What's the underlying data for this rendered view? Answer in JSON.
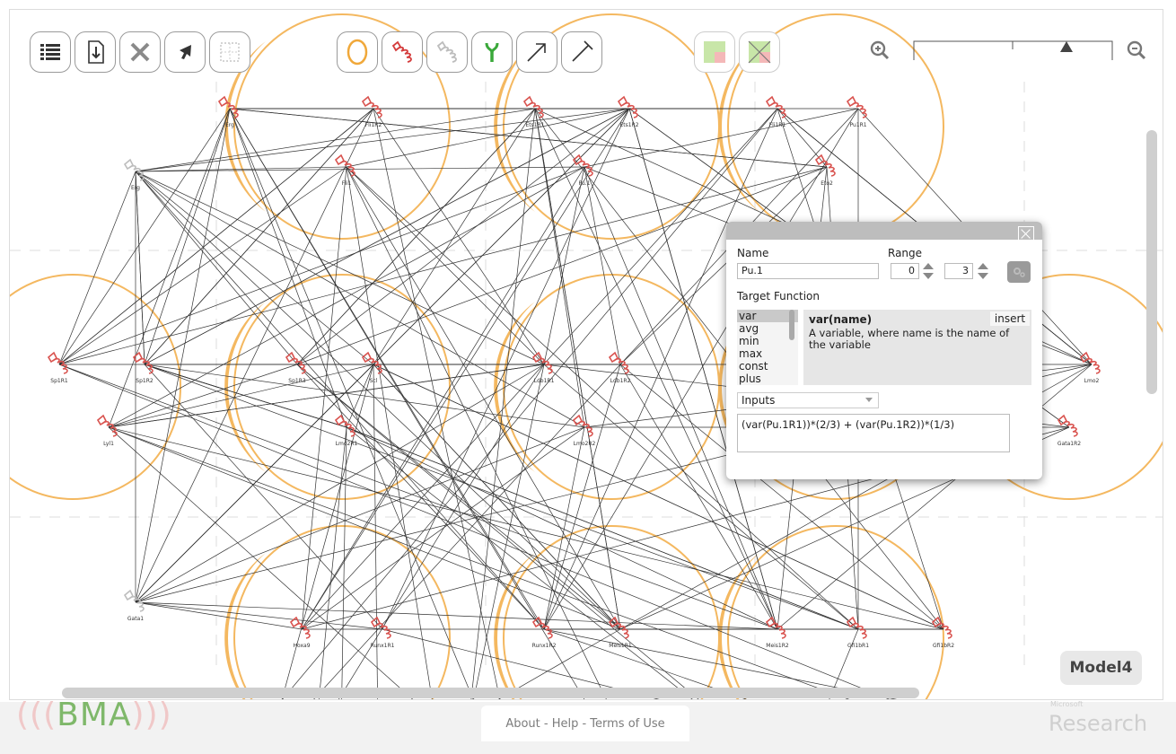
{
  "toolbar": {
    "left_group": [
      "list-icon",
      "save-download-icon",
      "delete-x-icon",
      "select-pointer-icon",
      "selection-grid-icon"
    ],
    "middle_group": [
      "cell-container-icon",
      "variable-icon",
      "constant-icon",
      "receptor-icon",
      "activator-arrow-icon",
      "inhibitor-arrow-icon"
    ],
    "right_group": [
      "grid-toggle-icon",
      "grid-off-icon"
    ]
  },
  "zoom": {
    "level": 0.8
  },
  "graph": {
    "node_labels": [
      "Erg",
      "Fli1R2",
      "Ets1R1",
      "Ets1R2",
      "Fli1R1",
      "Pu1R1",
      "Erg",
      "Fli1",
      "Pu.1",
      "Eto2",
      "Sp1R1",
      "Sp1R2",
      "Sp1R3",
      "Scl",
      "Ldb1R1",
      "Ldb1R2",
      "Lyl1",
      "Lmo2R1",
      "Lmo2R2",
      "Lmo2",
      "Gata1R2",
      "Gata1",
      "Hoxa9",
      "Runx1R1",
      "Runx1R2",
      "Meis1R1",
      "Meis1R2",
      "Gfi1bR1",
      "Gfi1bR2"
    ],
    "colors": {
      "container": "#f4b860",
      "node_active": "#d9534f",
      "node_inactive": "#bdbdbd",
      "edge": "#333333"
    }
  },
  "dialog": {
    "name_label": "Name",
    "name_value": "Pu.1",
    "range_label": "Range",
    "range_min": "0",
    "range_max": "3",
    "target_label": "Target Function",
    "functions": [
      "var",
      "avg",
      "min",
      "max",
      "const",
      "plus"
    ],
    "selected_function": "var",
    "desc_title": "var(name)",
    "insert_label": "insert",
    "desc_text": "A variable, where name is the name of the variable",
    "inputs_label": "Inputs",
    "formula": "(var(Pu.1R1))*(2/3) + (var(Pu.1R2))*(1/3)"
  },
  "model_name": "Model4",
  "footer": {
    "logo_text": "BMA",
    "links": "About - Help - Terms of Use",
    "ms_small": "Microsoft",
    "ms_big": "Research"
  }
}
